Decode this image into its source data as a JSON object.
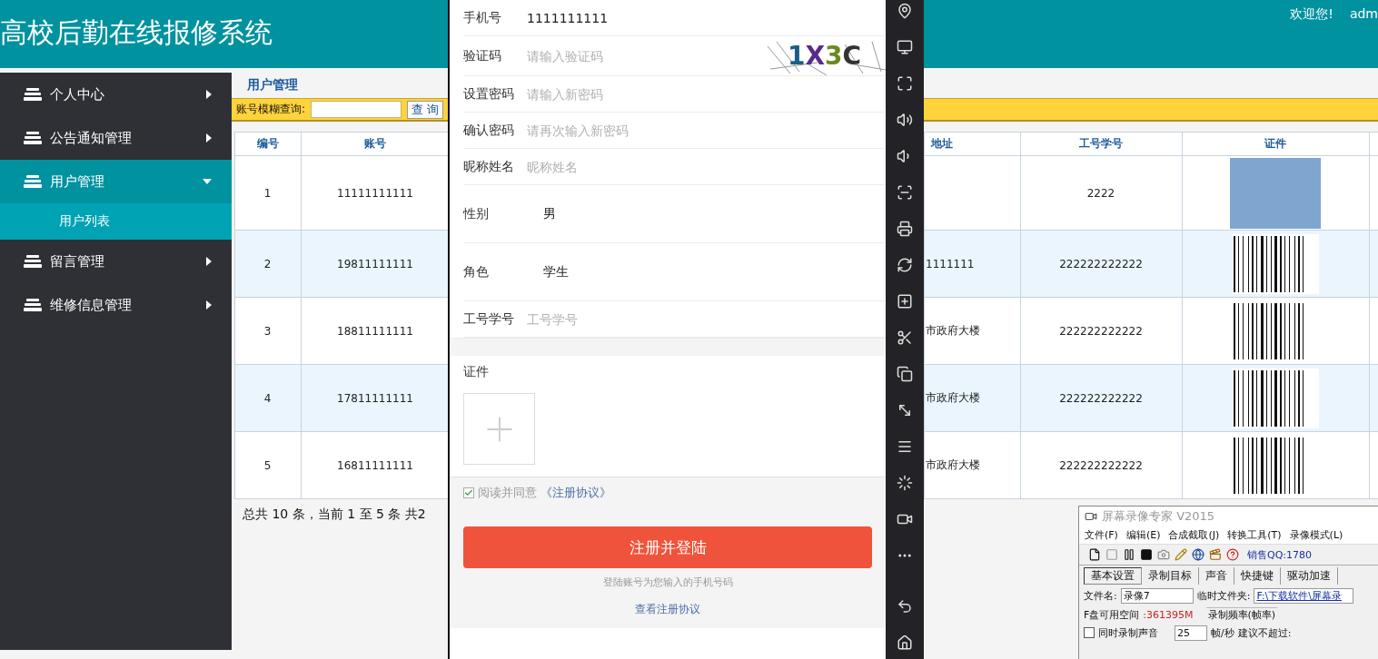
{
  "header": {
    "title": "高校后勤在线报修系统",
    "welcome": "欢迎您!",
    "user": "adm"
  },
  "sidebar": {
    "items": [
      {
        "label": "个人中心",
        "expanded": false
      },
      {
        "label": "公告通知管理",
        "expanded": false
      },
      {
        "label": "用户管理",
        "expanded": true,
        "children": [
          {
            "label": "用户列表",
            "selected": true
          }
        ]
      },
      {
        "label": "留言管理",
        "expanded": false
      },
      {
        "label": "维修信息管理",
        "expanded": false
      }
    ]
  },
  "content": {
    "title": "用户管理",
    "search": {
      "label": "账号模糊查询:",
      "button": "查 询"
    },
    "table": {
      "columns": [
        "编号",
        "账号",
        "地址",
        "工号学号",
        "证件"
      ],
      "rows": [
        {
          "no": "1",
          "account": "11111111111",
          "staff_no": "2222",
          "kind": "photo"
        },
        {
          "no": "2",
          "account": "19811111111",
          "address": "1111111",
          "staff_no": "222222222222",
          "kind": "barcode"
        },
        {
          "no": "3",
          "account": "18811111111",
          "address": "市政府大楼",
          "staff_no": "222222222222",
          "kind": "barcode"
        },
        {
          "no": "4",
          "account": "17811111111",
          "address": "市政府大楼",
          "staff_no": "222222222222",
          "kind": "barcode"
        },
        {
          "no": "5",
          "account": "16811111111",
          "address": "市政府大楼",
          "staff_no": "222222222222",
          "kind": "barcode"
        }
      ]
    },
    "pager": "总共 10 条，当前 1 至 5 条 共2"
  },
  "register": {
    "fields": [
      {
        "kind": "input",
        "label": "手机号",
        "value": "1111111111"
      },
      {
        "kind": "captcha",
        "label": "验证码",
        "placeholder": "请输入验证码",
        "captcha": "1X3C"
      },
      {
        "kind": "input",
        "label": "设置密码",
        "placeholder": "请输入新密码"
      },
      {
        "kind": "input",
        "label": "确认密码",
        "placeholder": "请再次输入新密码"
      },
      {
        "kind": "input",
        "label": "昵称姓名",
        "placeholder": "昵称姓名"
      },
      {
        "kind": "select",
        "label": "性别",
        "value": "男"
      },
      {
        "kind": "select",
        "label": "角色",
        "value": "学生"
      },
      {
        "kind": "input",
        "label": "工号学号",
        "placeholder": "工号学号"
      }
    ],
    "upload": {
      "label": "证件"
    },
    "agreement": {
      "checked": true,
      "text": "阅读并同意",
      "link": "《注册协议》"
    },
    "submit": "注册并登陆",
    "hint": "登陆账号为您输入的手机号码",
    "terms_link": "查看注册协议"
  },
  "recorder": {
    "title": "屏幕录像专家 V2015",
    "menu": [
      "文件(F)",
      "编辑(E)",
      "合成截取(J)",
      "转换工具(T)",
      "录像模式(L)"
    ],
    "sales": "销售QQ:1780",
    "tabs": [
      {
        "label": "基本设置",
        "selected": true
      },
      {
        "label": "录制目标",
        "selected": false
      },
      {
        "label": "声音",
        "selected": false
      },
      {
        "label": "快捷键",
        "selected": false
      },
      {
        "label": "驱动加速",
        "selected": false
      }
    ],
    "filename": {
      "label": "文件名:",
      "value": "录像7"
    },
    "temp_folder": {
      "label": "临时文件夹:",
      "value": "F:\\下载软件\\屏幕录"
    },
    "disk": {
      "label": "F盘可用空间",
      "value": ":361395M"
    },
    "frame_rate": {
      "legend": "录制频率(帧率)",
      "value": "25",
      "unit": "帧/秒",
      "advice": "建议不超过:"
    },
    "record_audio": {
      "label": "同时录制声音",
      "checked": false
    }
  }
}
